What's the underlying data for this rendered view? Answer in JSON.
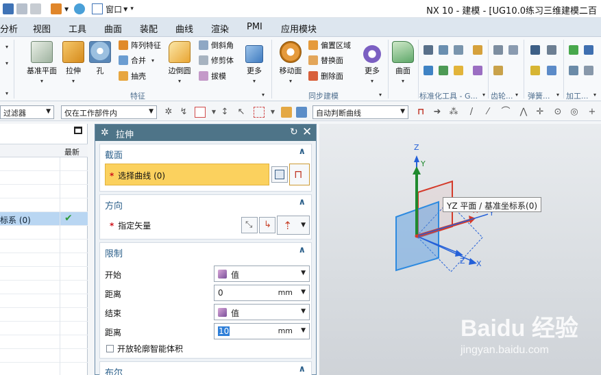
{
  "window": {
    "title": "NX 10 - 建模 - [UG10.0练习三维建模二百"
  },
  "quick_access": {
    "window_menu": "窗口"
  },
  "menu": [
    "分析",
    "视图",
    "工具",
    "曲面",
    "装配",
    "曲线",
    "渲染",
    "PMI",
    "应用模块"
  ],
  "ribbon": {
    "feature_group": "特征",
    "sync_group": "同步建模",
    "std_group": "标准化工具 - G...",
    "gear_group": "齿轮...",
    "spring_group": "弹簧...",
    "machining_group": "加工...",
    "big_buttons": {
      "datum_plane": "基准平面",
      "extrude": "拉伸",
      "hole": "孔",
      "edge_blend": "边倒圆",
      "more_feature": "更多",
      "move_face": "移动面",
      "more_sync": "更多",
      "surface": "曲面"
    },
    "small_buttons": {
      "pattern": "阵列特征",
      "unite": "合并",
      "shell": "抽壳",
      "chamfer": "倒斜角",
      "trim_body": "修剪体",
      "draft": "拔模",
      "offset_region": "偏置区域",
      "replace_face": "替换面",
      "delete_face": "删除面"
    }
  },
  "toolbar": {
    "type_filter": "过滤器",
    "scope": "仅在工作部件内",
    "curve_rule": "自动判断曲线"
  },
  "navigator": {
    "column_latest": "最新",
    "selected_row": "标系 (0)"
  },
  "dialog": {
    "title": "拉伸",
    "section": {
      "title": "截面",
      "select_curve": "选择曲线 (0)"
    },
    "direction": {
      "title": "方向",
      "vector": "指定矢量"
    },
    "limits": {
      "title": "限制",
      "start_label": "开始",
      "start_value": "值",
      "distance_label_1": "距离",
      "distance_value_1": "0",
      "unit_1": "mm",
      "end_label": "结束",
      "end_value": "值",
      "distance_label_2": "距离",
      "distance_value_2": "10",
      "unit_2": "mm",
      "open_profile": "开放轮廓智能体积"
    },
    "boolean": {
      "title": "布尔"
    }
  },
  "viewport": {
    "tooltip": "YZ 平面 / 基准坐标系(0)",
    "axis_z": "Z",
    "axis_y": "Y",
    "axis_x": "X",
    "axis_zc": "Z",
    "axis_yc": "Y",
    "axis_xc": "X"
  },
  "watermark": {
    "brand": "Baidu 经验",
    "url": "jingyan.baidu.com"
  },
  "colors": {
    "accent": "#4e7488",
    "selected_section": "#fbd15e",
    "axis_z": "#2460d8",
    "axis_y": "#1f8a2e",
    "axis_x": "#d43a2a",
    "plane": "#4d97e0"
  }
}
